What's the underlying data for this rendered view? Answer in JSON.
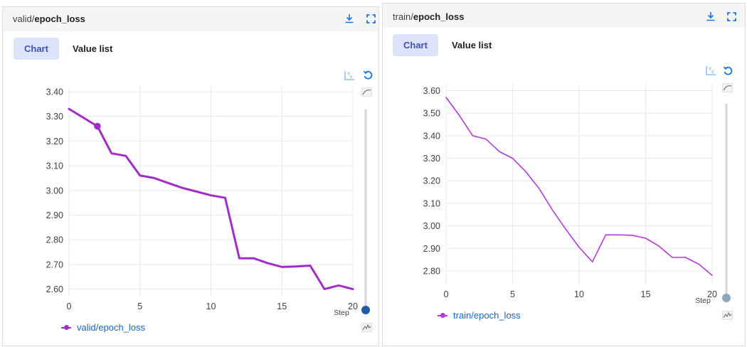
{
  "panels": [
    {
      "title_run": "valid/",
      "title_tag": "epoch_loss",
      "tabs": {
        "chart": "Chart",
        "value_list": "Value list"
      },
      "legend_label": "valid/epoch_loss",
      "step_label": "Step"
    },
    {
      "title_run": "train/",
      "title_tag": "epoch_loss",
      "tabs": {
        "chart": "Chart",
        "value_list": "Value list"
      },
      "legend_label": "train/epoch_loss",
      "step_label": "Step"
    }
  ],
  "icons": {
    "download": "download-icon",
    "fullscreen": "fullscreen-icon",
    "fit_axes": "fit-axes-icon",
    "reset": "reset-icon",
    "smoothing": "smoothing-icon",
    "raw": "raw-data-icon"
  },
  "colors": {
    "valid_series": "#a02ec6",
    "train_series": "#b33ad6",
    "tab_active_bg": "#dde3f8",
    "tab_active_text": "#3f51b5",
    "slider_thumb_left": "#1f5cab",
    "slider_thumb_right": "#8fa7b8",
    "icon_blue": "#1a73e8"
  },
  "chart_data": [
    {
      "type": "line",
      "series": [
        {
          "name": "valid/epoch_loss",
          "x": [
            0,
            1,
            2,
            3,
            4,
            5,
            6,
            7,
            8,
            9,
            10,
            11,
            12,
            13,
            14,
            15,
            16,
            17,
            18,
            19,
            20
          ],
          "y": [
            3.33,
            3.295,
            3.26,
            3.15,
            3.14,
            3.06,
            3.05,
            3.03,
            3.01,
            2.995,
            2.98,
            2.97,
            2.725,
            2.725,
            2.705,
            2.69,
            2.692,
            2.695,
            2.6,
            2.615,
            2.6
          ]
        }
      ],
      "highlight_point": {
        "x": 2,
        "y": 3.26
      },
      "xticks": [
        0,
        5,
        10,
        15,
        20
      ],
      "yticks": [
        "2.60",
        "2.70",
        "2.80",
        "2.90",
        "3.00",
        "3.10",
        "3.20",
        "3.30",
        "3.40"
      ],
      "xlim": [
        0,
        20
      ],
      "ylim": [
        2.57,
        3.42
      ],
      "xlabel": "Step",
      "grid": true,
      "legend": "bottom-left"
    },
    {
      "type": "line",
      "series": [
        {
          "name": "train/epoch_loss",
          "x": [
            0,
            1,
            2,
            3,
            4,
            5,
            6,
            7,
            8,
            9,
            10,
            11,
            12,
            13,
            14,
            15,
            16,
            17,
            18,
            19,
            20
          ],
          "y": [
            3.57,
            3.49,
            3.4,
            3.385,
            3.33,
            3.3,
            3.24,
            3.165,
            3.07,
            2.985,
            2.905,
            2.84,
            2.96,
            2.96,
            2.958,
            2.945,
            2.91,
            2.86,
            2.86,
            2.83,
            2.78
          ]
        }
      ],
      "xticks": [
        0,
        5,
        10,
        15,
        20
      ],
      "yticks": [
        "2.80",
        "2.90",
        "3.00",
        "3.10",
        "3.20",
        "3.30",
        "3.40",
        "3.50",
        "3.60"
      ],
      "xlim": [
        0,
        20
      ],
      "ylim": [
        2.74,
        3.63
      ],
      "xlabel": "Step",
      "grid": true,
      "legend": "bottom-left"
    }
  ]
}
